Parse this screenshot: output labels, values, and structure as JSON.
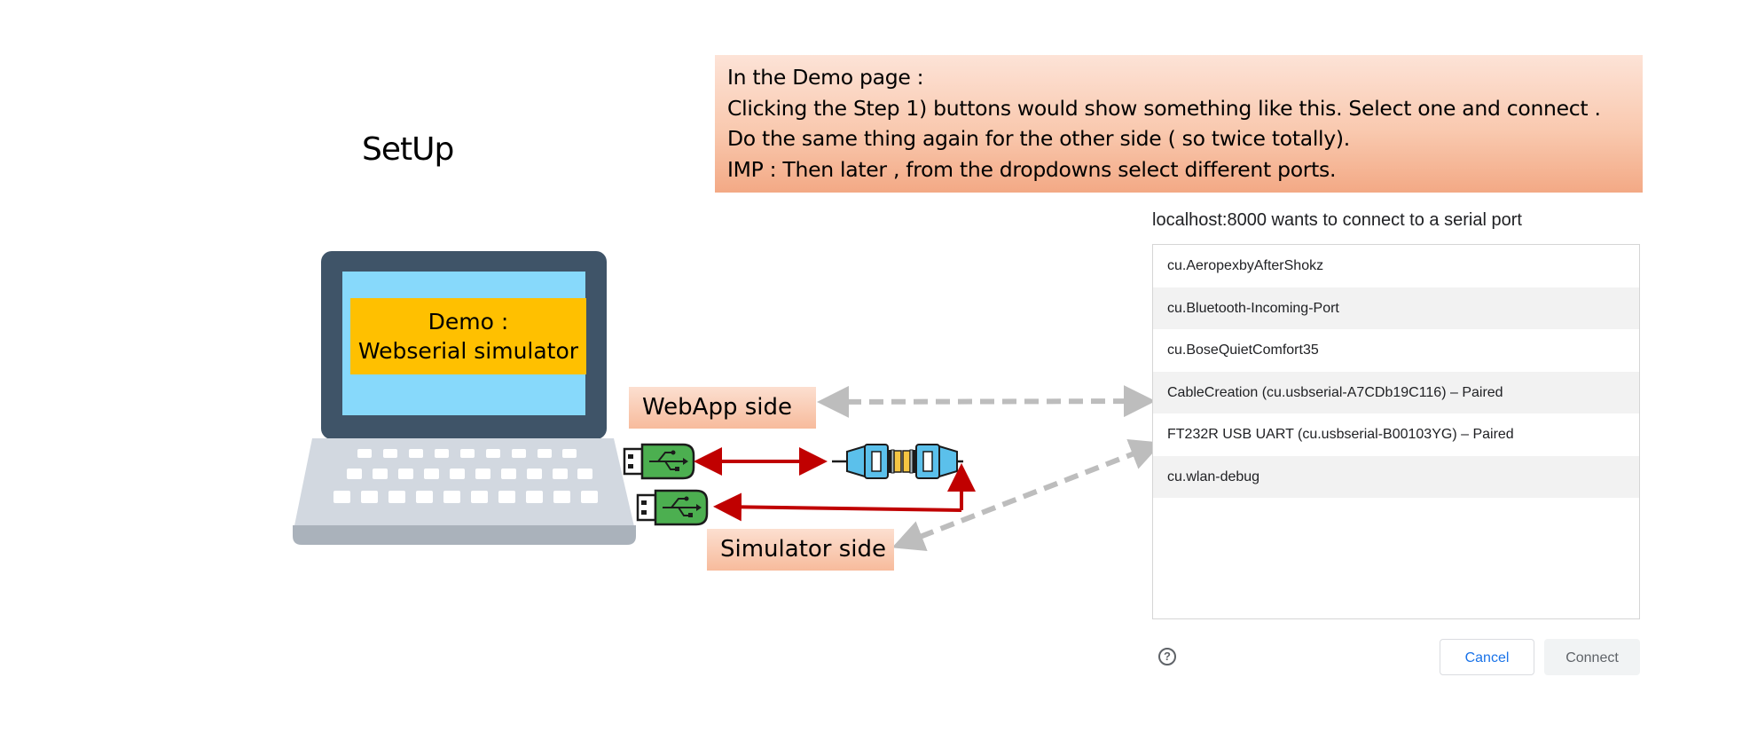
{
  "title": "SetUp",
  "note": {
    "lines": [
      "In the Demo page :",
      "Clicking the Step 1) buttons would show something like this. Select one and connect .",
      "Do the same thing again for the other side ( so twice totally).",
      "IMP : Then later , from the dropdowns select different ports."
    ]
  },
  "laptop": {
    "screen_label_line1": "Demo :",
    "screen_label_line2": "Webserial simulator"
  },
  "labels": {
    "webapp_side": "WebApp side",
    "simulator_side": "Simulator side"
  },
  "dialog": {
    "prompt": "localhost:8000 wants to connect to a serial port",
    "ports": [
      "cu.AeropexbyAfterShokz",
      "cu.Bluetooth-Incoming-Port",
      "cu.BoseQuietComfort35",
      "CableCreation (cu.usbserial-A7CDb19C116) – Paired",
      "FT232R USB UART (cu.usbserial-B00103YG) – Paired",
      "cu.wlan-debug"
    ],
    "help_glyph": "?",
    "cancel_label": "Cancel",
    "connect_label": "Connect"
  },
  "colors": {
    "laptop_frame": "#3f5468",
    "laptop_screen": "#87d9fb",
    "laptop_base": "#d2d8e0",
    "screen_label_bg": "#ffc000",
    "usb_green": "#4caf50",
    "connector_blue": "#5bc0eb",
    "red_arrow": "#c00000",
    "grey_arrow": "#bdbdbd",
    "cancel_text": "#1a73e8"
  },
  "icons": [
    "laptop-icon",
    "usb-stick-icon",
    "serial-connector-icon",
    "help-icon"
  ]
}
